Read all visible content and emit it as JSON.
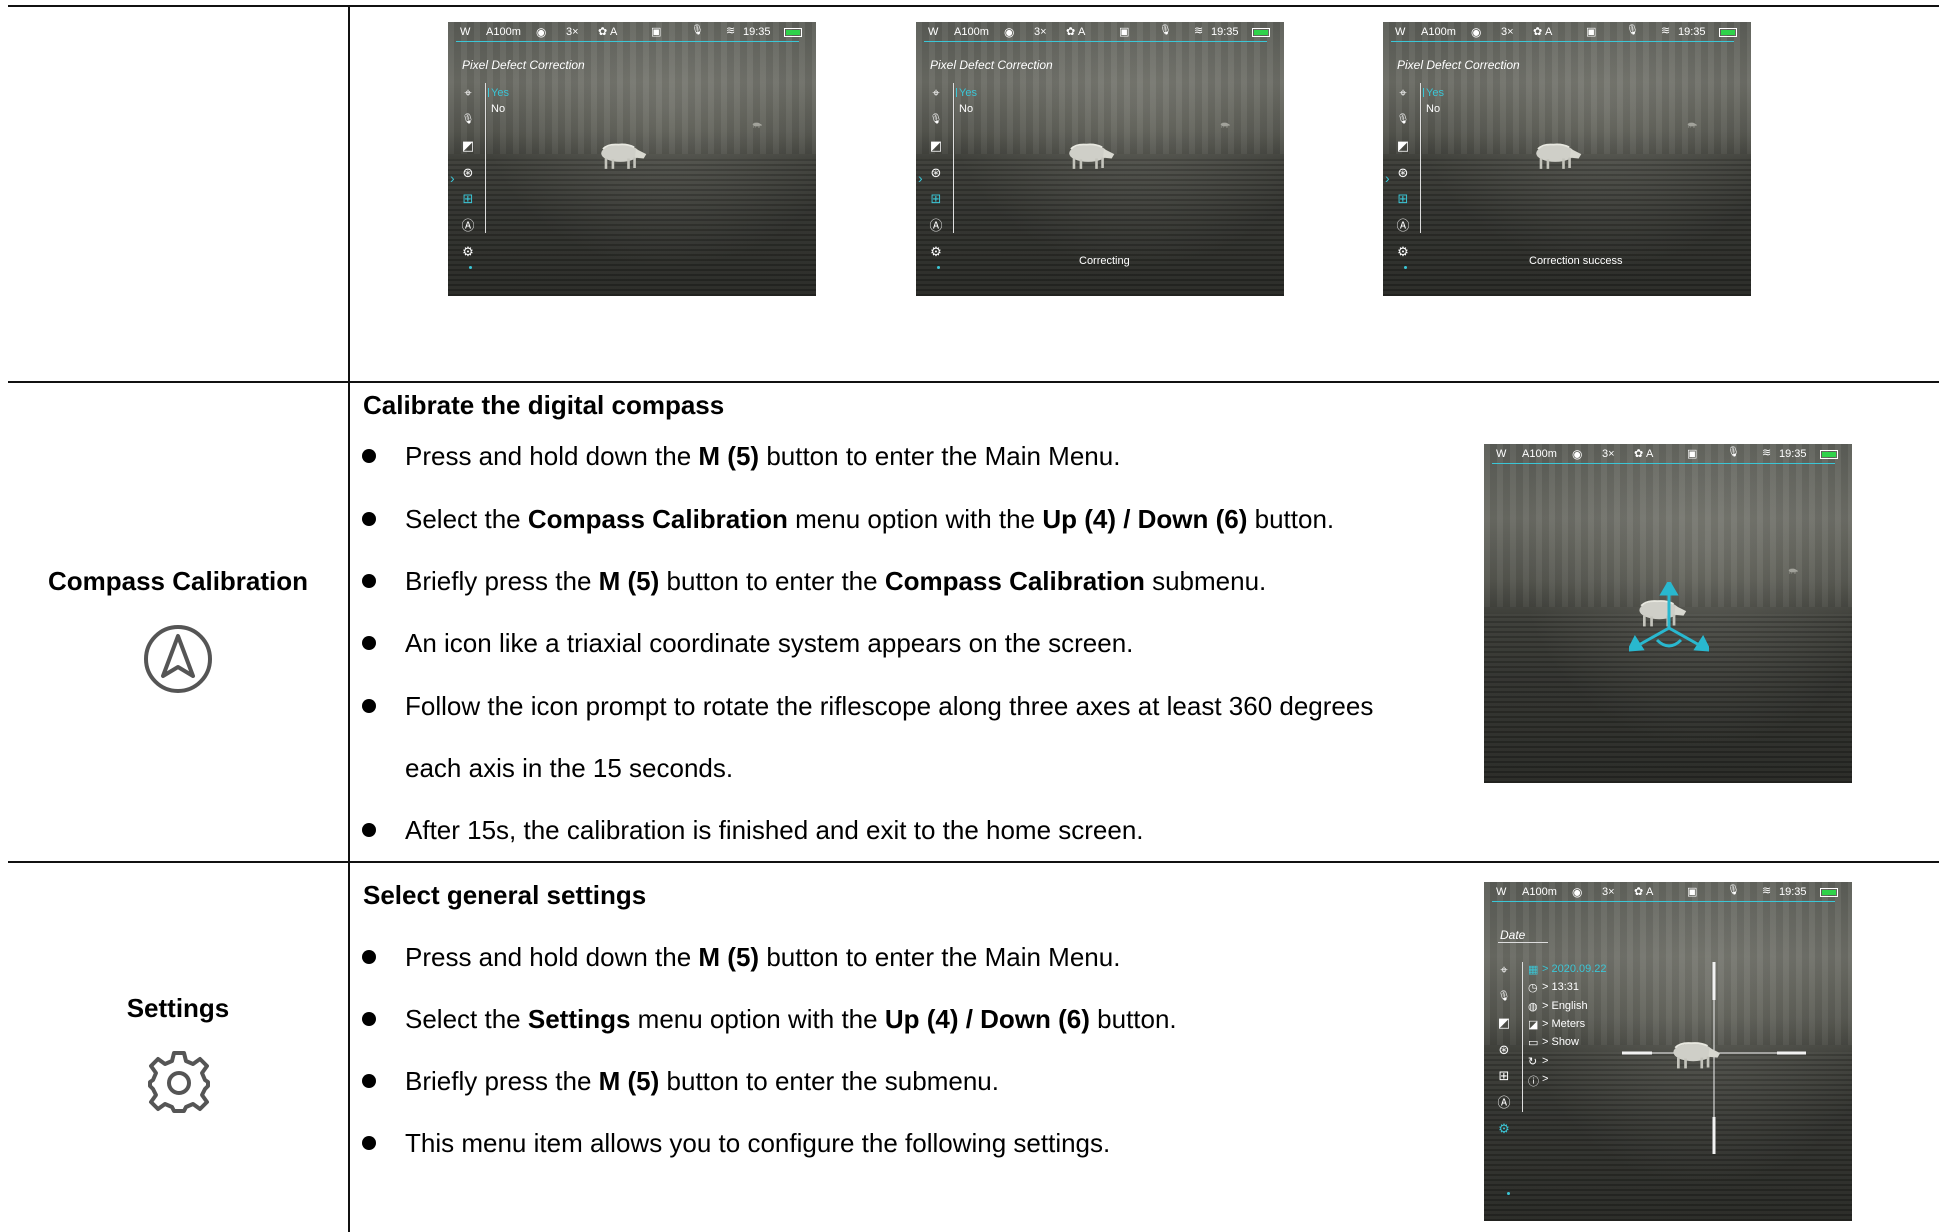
{
  "status_bar": {
    "w": "W",
    "range": "A100m",
    "zoom": "3×",
    "mode": "A",
    "time": "19:35"
  },
  "pixel_defect": {
    "menu_title": "Pixel Defect Correction",
    "option_yes": "Yes",
    "option_no": "No",
    "msg_correcting": "Correcting",
    "msg_success": "Correction success"
  },
  "compass": {
    "row_label": "Compass Calibration",
    "section_title": "Calibrate the digital compass",
    "bullets": [
      {
        "pre": "Press and hold down the ",
        "b1": "M (5)",
        "post": " button to enter the Main Menu."
      },
      {
        "pre": "Select the ",
        "b1": "Compass Calibration",
        "mid": " menu option with the ",
        "b2": "Up (4) / Down (6)",
        "post": " button."
      },
      {
        "pre": "Briefly press the ",
        "b1": "M (5)",
        "mid": " button to enter the ",
        "b2": "Compass Calibration",
        "post": " submenu."
      },
      {
        "text": "An icon like a triaxial coordinate system appears on the screen."
      },
      {
        "text": "Follow the icon prompt to rotate the riflescope along three axes at least 360 degrees",
        "cont": "each axis in the 15 seconds."
      },
      {
        "text": "After 15s, the calibration is finished and exit to the home screen."
      }
    ]
  },
  "settings": {
    "row_label": "Settings",
    "section_title": "Select general settings",
    "bullets": [
      {
        "pre": "Press and hold down the ",
        "b1": "M (5)",
        "post": " button to enter the Main Menu."
      },
      {
        "pre": "Select the ",
        "b1": "Settings",
        "mid": " menu option with the ",
        "b2": "Up (4) / Down (6)",
        "post": " button."
      },
      {
        "pre": "Briefly press the ",
        "b1": "M (5)",
        "post": " button to enter the submenu."
      },
      {
        "text": "This menu item allows you to configure the following settings."
      }
    ],
    "screen": {
      "menu_title": "Date",
      "items": [
        "> 2020.09.22",
        "> 13:31",
        "> English",
        "> Meters",
        "> Show",
        ">",
        ">"
      ]
    }
  },
  "colors": {
    "accent": "#3bc6d6",
    "battery": "#2fd24a"
  }
}
